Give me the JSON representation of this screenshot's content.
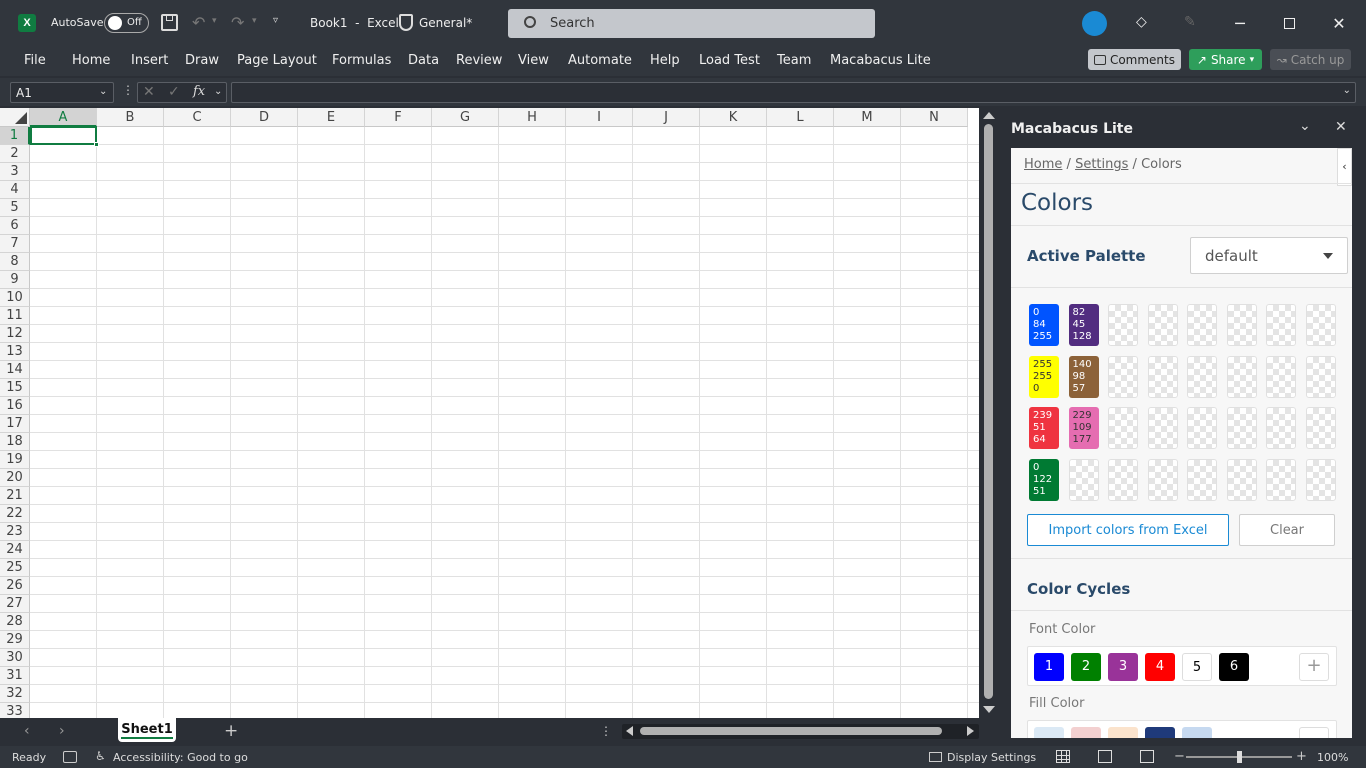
{
  "titlebar": {
    "autosave_label": "AutoSave",
    "autosave_state": "Off",
    "doc_title": "Book1  -  Excel",
    "sensitivity": "General*",
    "search_placeholder": "Search"
  },
  "ribbon": {
    "tabs": [
      "File",
      "Home",
      "Insert",
      "Draw",
      "Page Layout",
      "Formulas",
      "Data",
      "Review",
      "View",
      "Automate",
      "Help",
      "Load Test",
      "Team",
      "Macabacus Lite"
    ],
    "comments_label": "Comments",
    "share_label": "Share",
    "catchup_label": "Catch up"
  },
  "formula_bar": {
    "name_box": "A1",
    "fx": "fx",
    "formula": ""
  },
  "grid": {
    "columns": [
      "A",
      "B",
      "C",
      "D",
      "E",
      "F",
      "G",
      "H",
      "I",
      "J",
      "K",
      "L",
      "M",
      "N"
    ],
    "rows": [
      "1",
      "2",
      "3",
      "4",
      "5",
      "6",
      "7",
      "8",
      "9",
      "10",
      "11",
      "12",
      "13",
      "14",
      "15",
      "16",
      "17",
      "18",
      "19",
      "20",
      "21",
      "22",
      "23",
      "24",
      "25",
      "26",
      "27",
      "28",
      "29",
      "30",
      "31",
      "32",
      "33"
    ],
    "selected_cell": "A1"
  },
  "sheets": {
    "active": "Sheet1"
  },
  "status": {
    "ready": "Ready",
    "accessibility": "Accessibility: Good to go",
    "display_settings": "Display Settings",
    "zoom": "100%",
    "zoom_fraction": 0.5
  },
  "pane": {
    "title": "Macabacus Lite",
    "breadcrumb": {
      "home": "Home",
      "sep1": "/",
      "settings": "Settings",
      "sep2": "/",
      "current": "Colors"
    },
    "heading": "Colors",
    "active_palette_label": "Active Palette",
    "palette_value": "default",
    "swatches": [
      {
        "r": "0",
        "g": "84",
        "b": "255",
        "color": "#0054ff",
        "text": "#ffffff"
      },
      {
        "r": "82",
        "g": "45",
        "b": "128",
        "color": "#522d80",
        "text": "#ffffff"
      },
      {
        "r": "255",
        "g": "255",
        "b": "0",
        "color": "#ffff00",
        "text": "#333333"
      },
      {
        "r": "140",
        "g": "98",
        "b": "57",
        "color": "#8c6239",
        "text": "#ffffff"
      },
      {
        "r": "239",
        "g": "51",
        "b": "64",
        "color": "#ef3340",
        "text": "#ffffff"
      },
      {
        "r": "229",
        "g": "109",
        "b": "177",
        "color": "#e56db1",
        "text": "#333333"
      },
      {
        "r": "0",
        "g": "122",
        "b": "51",
        "color": "#007a33",
        "text": "#ffffff"
      }
    ],
    "import_label": "Import colors from Excel",
    "clear_label": "Clear",
    "color_cycles_label": "Color Cycles",
    "font_color_label": "Font Color",
    "font_cycle": [
      {
        "n": "1",
        "color": "#0000ff",
        "text": "#ffffff"
      },
      {
        "n": "2",
        "color": "#008000",
        "text": "#ffffff"
      },
      {
        "n": "3",
        "color": "#993399",
        "text": "#ffffff"
      },
      {
        "n": "4",
        "color": "#ff0000",
        "text": "#ffffff"
      },
      {
        "n": "5",
        "color": "#ffffff",
        "text": "#000000"
      },
      {
        "n": "6",
        "color": "#000000",
        "text": "#ffffff"
      }
    ],
    "fill_color_label": "Fill Color",
    "fill_cycle": [
      "#dbe9f5",
      "#f3d0d0",
      "#fbe3cc",
      "#1f3a7a",
      "#c6d9f0"
    ]
  },
  "colors": {
    "excel_green": "#107c41",
    "share_green": "#2e9e5b",
    "import_blue": "#1a8ad4"
  }
}
